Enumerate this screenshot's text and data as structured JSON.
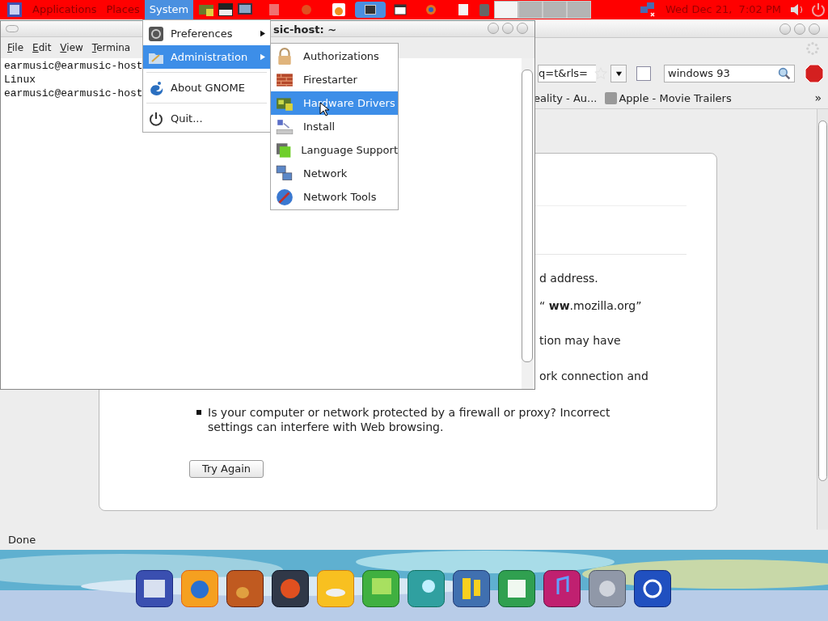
{
  "top_panel": {
    "menus": [
      {
        "label": "Applications",
        "selected": false
      },
      {
        "label": "Places",
        "selected": false
      },
      {
        "label": "System",
        "selected": true
      }
    ],
    "clock": "Wed Dec 21,  7:02 PM"
  },
  "system_menu": {
    "items": [
      {
        "kind": "item",
        "label": "Preferences",
        "submenu": true,
        "selected": false
      },
      {
        "kind": "item",
        "label": "Administration",
        "submenu": true,
        "selected": true
      },
      {
        "kind": "separator"
      },
      {
        "kind": "item",
        "label": "About GNOME",
        "submenu": false,
        "selected": false
      },
      {
        "kind": "separator"
      },
      {
        "kind": "item",
        "label": "Quit...",
        "submenu": false,
        "selected": false
      }
    ]
  },
  "administration_menu": {
    "items": [
      {
        "label": "Authorizations",
        "selected": false
      },
      {
        "label": "Firestarter",
        "selected": false
      },
      {
        "label": "Hardware Drivers",
        "selected": true
      },
      {
        "label": "Install",
        "selected": false
      },
      {
        "label": "Language Support",
        "selected": false
      },
      {
        "label": "Network",
        "selected": false
      },
      {
        "label": "Network Tools",
        "selected": false
      }
    ]
  },
  "terminal": {
    "title": "sic-host: ~",
    "menu": [
      "File",
      "Edit",
      "View",
      "Termina"
    ],
    "lines": [
      "earmusic@earmusic-host",
      "Linux",
      "earmusic@earmusic-host"
    ]
  },
  "browser": {
    "url": "q=t&rls=",
    "search": {
      "value": "windows 93"
    },
    "bookmarks": [
      "eality - Au...",
      "Apple - Movie Trailers"
    ],
    "bookmarks_overflow": "»",
    "error_fragments": [
      "d address.",
      "“ **ww**.mozilla.org”",
      "tion may have",
      "ork connection and"
    ],
    "bullets": [
      "Is your computer or network protected by a firewall or proxy? Incorrect settings can interfere with Web browsing."
    ],
    "button": "Try Again",
    "status": "Done"
  }
}
